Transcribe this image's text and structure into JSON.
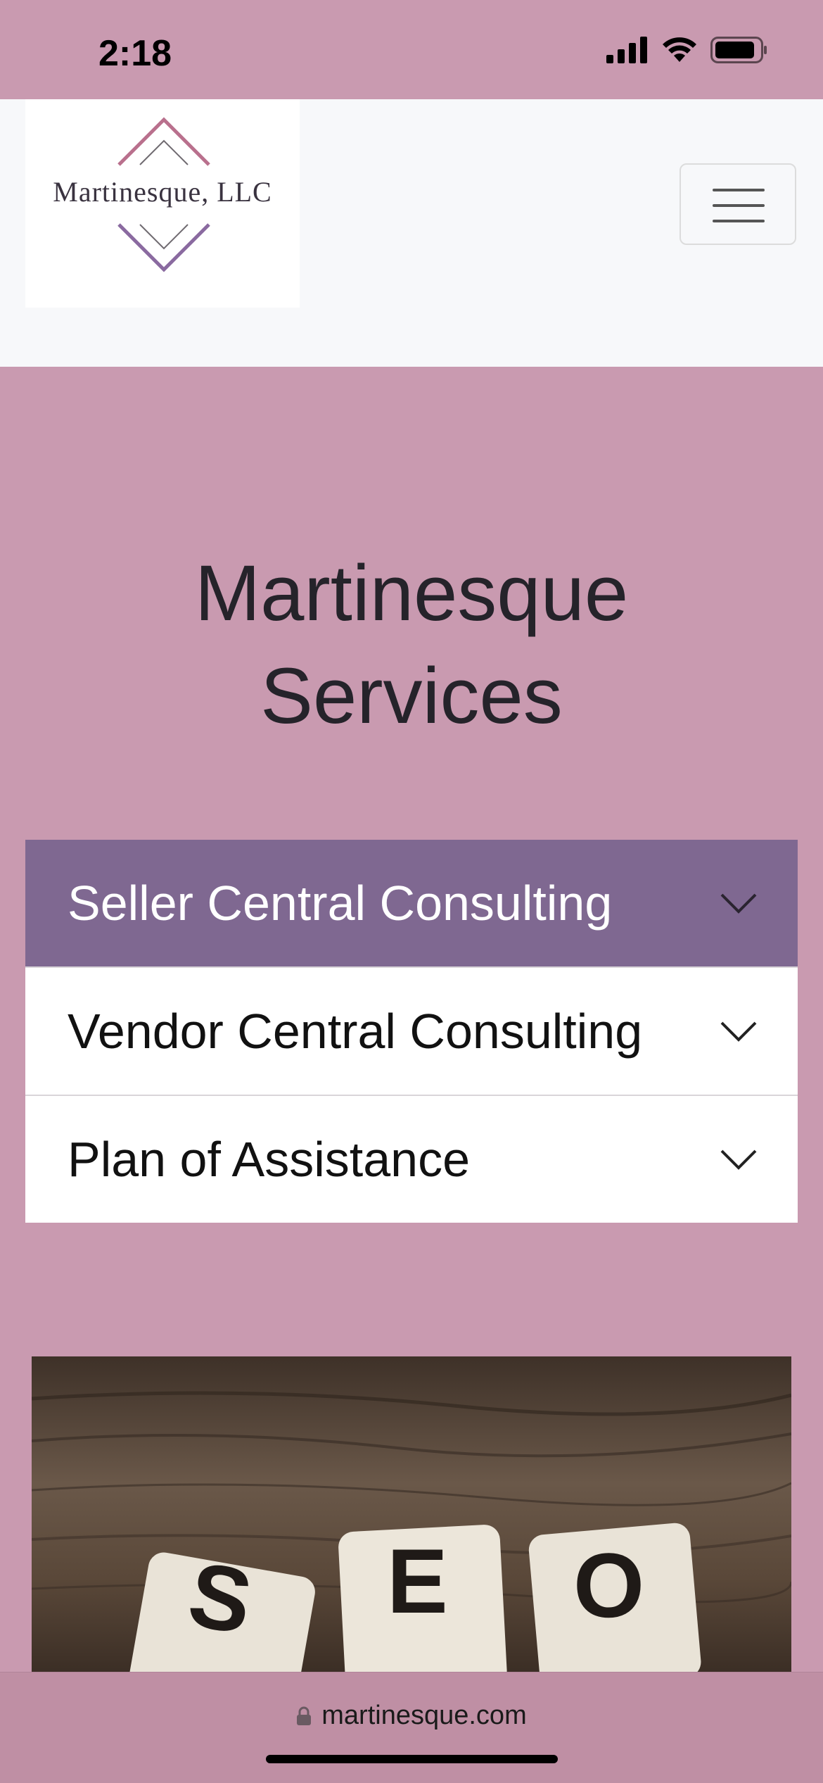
{
  "status_bar": {
    "time": "2:18"
  },
  "navbar": {
    "logo_text": "Martinesque, LLC",
    "menu_icon": "hamburger-icon"
  },
  "main": {
    "title": "Martinesque Services",
    "accordion": [
      {
        "label": "Seller Central Consulting",
        "active": true
      },
      {
        "label": "Vendor Central Consulting",
        "active": false
      },
      {
        "label": "Plan of Assistance",
        "active": false
      }
    ],
    "image_tiles": [
      "S",
      "E",
      "O"
    ]
  },
  "browser": {
    "url": "martinesque.com"
  },
  "colors": {
    "page_bg": "#c99ab0",
    "navbar_bg": "#f7f8fa",
    "accent": "#7f6891",
    "logo_rose": "#b9708d",
    "logo_purple": "#8a6aa0"
  }
}
